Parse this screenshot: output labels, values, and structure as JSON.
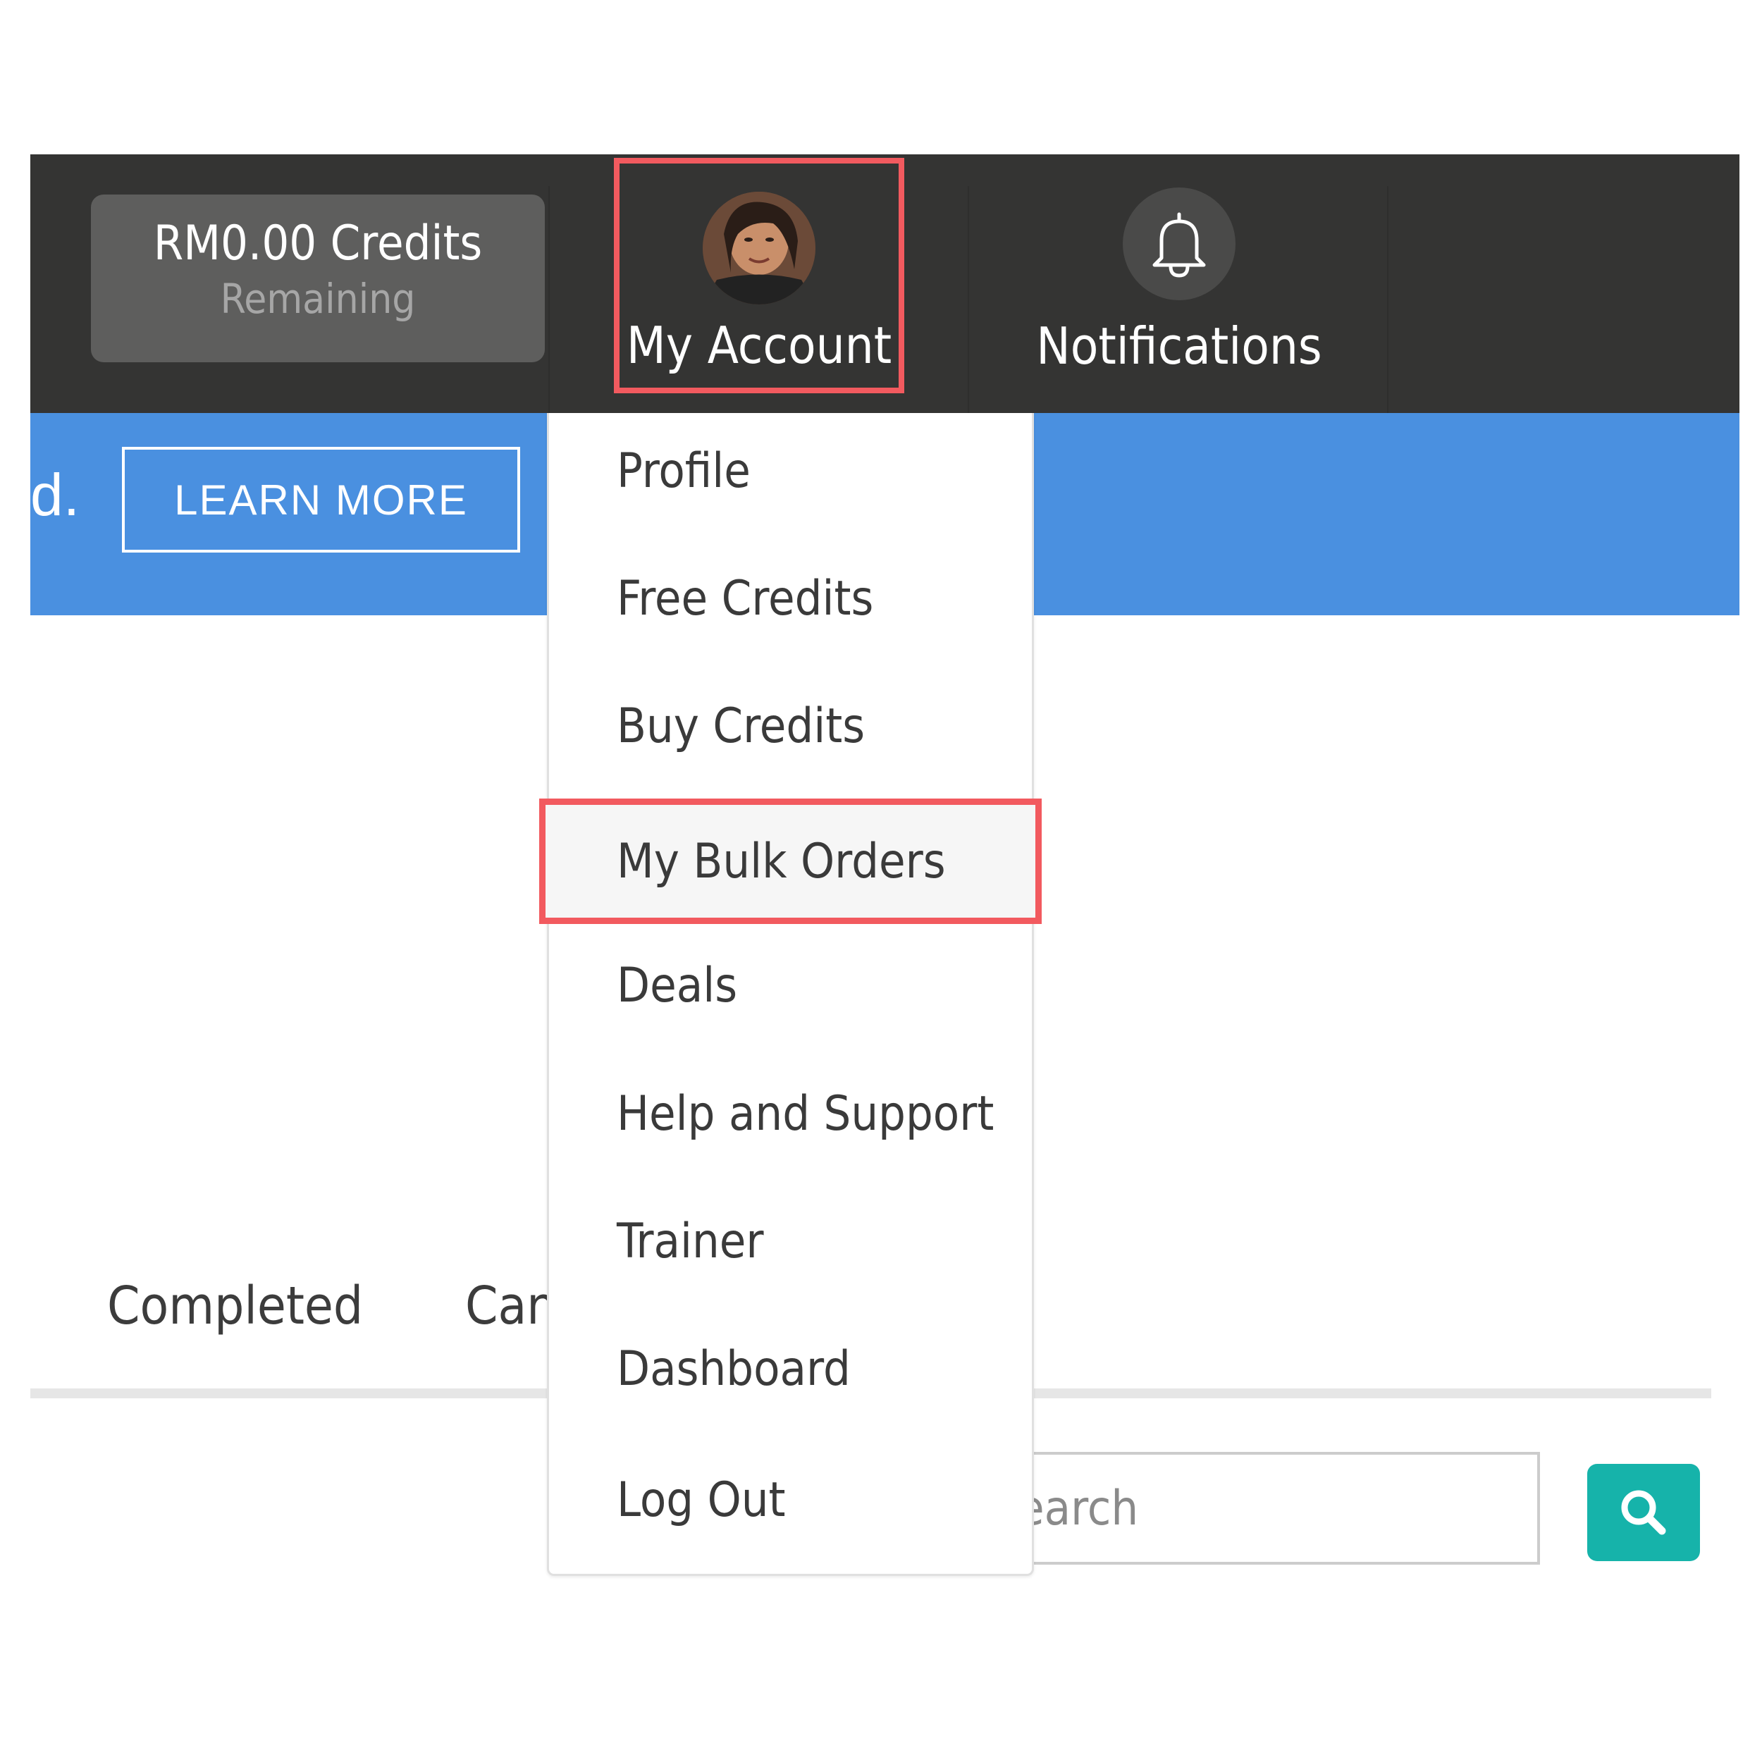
{
  "navbar": {
    "credits": {
      "amount": "RM0.00 Credits",
      "subtitle": "Remaining"
    },
    "account": {
      "label": "My Account",
      "avatar_icon": "user-avatar"
    },
    "notifications": {
      "label": "Notifications",
      "icon": "bell-icon"
    }
  },
  "banner": {
    "text_fragment": "d.",
    "learn_more_label": "LEARN MORE",
    "background_color": "#4a90e0"
  },
  "account_menu": {
    "items": [
      {
        "label": "Profile"
      },
      {
        "label": "Free Credits"
      },
      {
        "label": "Buy Credits"
      },
      {
        "label": "My Bulk Orders",
        "highlighted": true
      },
      {
        "label": "Deals"
      },
      {
        "label": "Help and Support"
      },
      {
        "label": "Trainer"
      },
      {
        "label": "Dashboard"
      },
      {
        "label": "Log Out"
      }
    ]
  },
  "tabs": [
    {
      "label": "Completed"
    },
    {
      "label": "Can"
    }
  ],
  "search": {
    "placeholder": "earch",
    "button_icon": "search-icon",
    "button_color": "#16b3aa"
  },
  "colors": {
    "navbar": "#343433",
    "highlight_border": "#f25a5f"
  }
}
